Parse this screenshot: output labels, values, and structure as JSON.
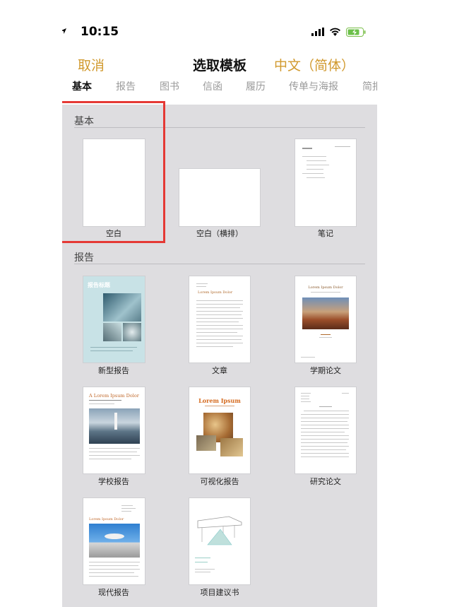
{
  "status": {
    "time": "10:15"
  },
  "nav": {
    "cancel": "取消",
    "title": "选取模板",
    "language": "中文（简体）"
  },
  "tabs": [
    "基本",
    "报告",
    "图书",
    "信函",
    "履历",
    "传单与海报",
    "简报"
  ],
  "sections": {
    "basic": {
      "title": "基本",
      "templates": [
        "空白",
        "空白（横排）",
        "笔记"
      ]
    },
    "report": {
      "title": "报告",
      "templates": [
        "新型报告",
        "文章",
        "学期论文",
        "学校报告",
        "可视化报告",
        "研究论文",
        "现代报告",
        "项目建议书"
      ]
    }
  },
  "thumb_text": {
    "report_title": "报告标题",
    "lorem": "Lorem Ipsum Dolor",
    "lorem_a": "A Lorem Ipsum Dolor",
    "lorem_short": "Lorem Ipsum"
  },
  "colors": {
    "accent": "#d19a2f",
    "highlight": "#e53935",
    "background": "#dedde0"
  }
}
